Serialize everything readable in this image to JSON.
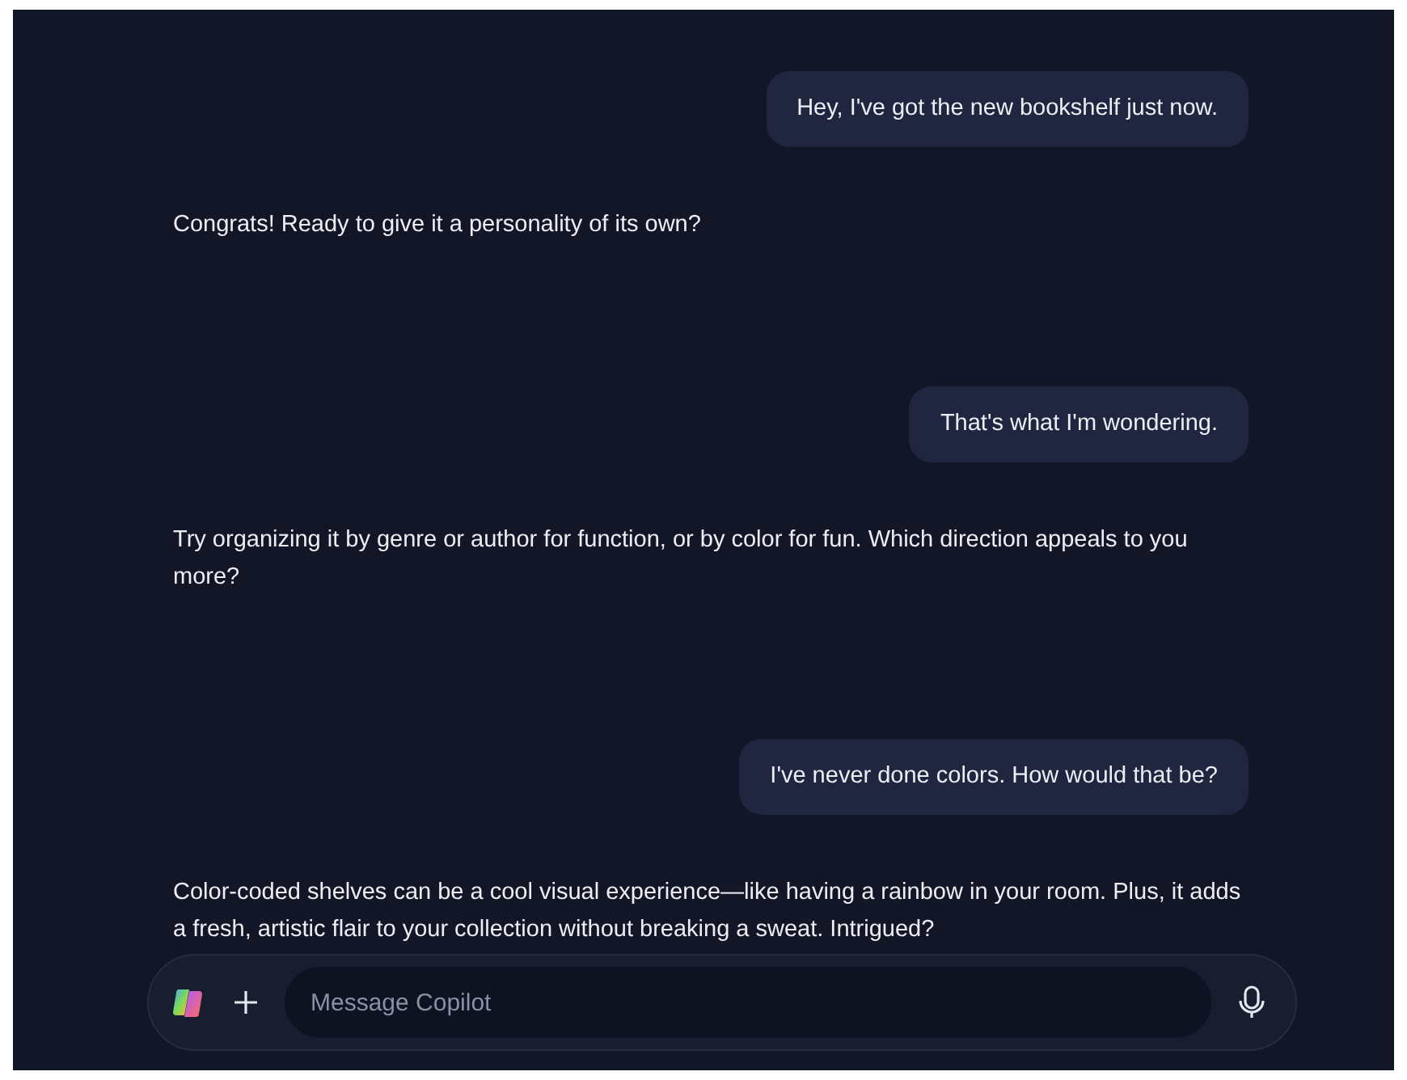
{
  "messages": [
    {
      "kind": "user",
      "text": "Hey, I've got the new bookshelf just now."
    },
    {
      "kind": "assistant",
      "text": "Congrats! Ready to give it a personality of its own?"
    },
    {
      "kind": "user",
      "text": "That's what I'm wondering."
    },
    {
      "kind": "assistant",
      "text": "Try organizing it by genre or author for function, or by color for fun. Which direction appeals to you more?"
    },
    {
      "kind": "user",
      "text": "I've never done colors. How would that be?"
    },
    {
      "kind": "assistant",
      "text": "Color-coded shelves can be a cool visual experience—like having a rainbow in your room. Plus, it adds a fresh, artistic flair to your collection without breaking a sweat. Intrigued?"
    }
  ],
  "composer": {
    "placeholder": "Message Copilot"
  }
}
